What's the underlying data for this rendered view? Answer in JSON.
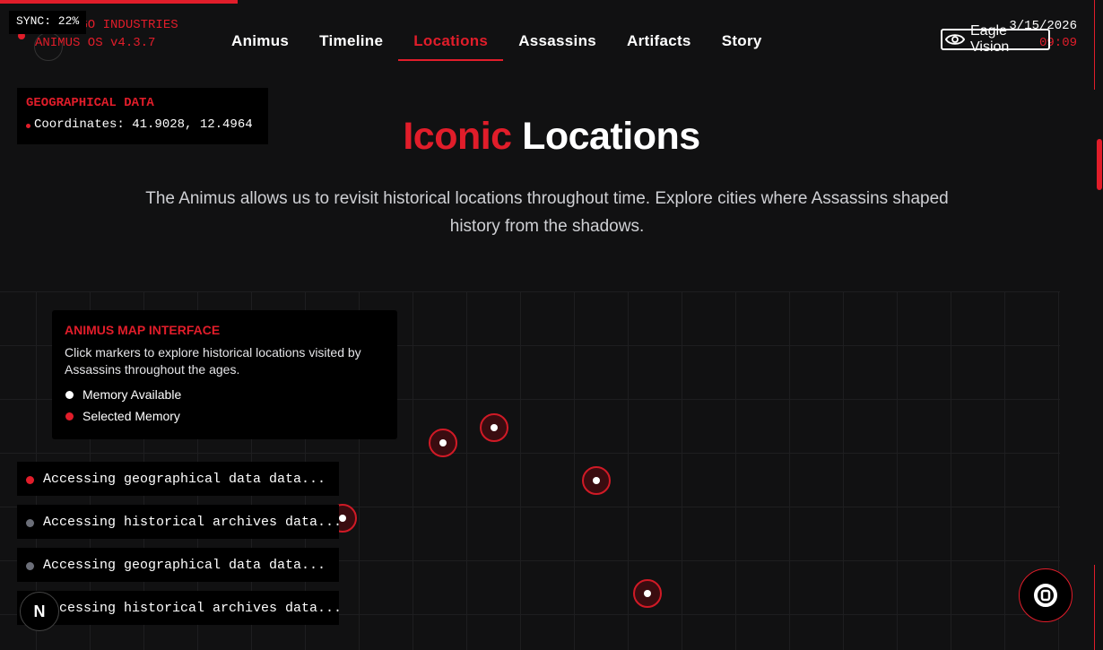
{
  "sync": {
    "label": "SYNC: 22%",
    "progress": 0.22
  },
  "brand": {
    "company": "ABSTERGO INDUSTRIES",
    "os": "ANIMUS OS v4.3.7"
  },
  "nav": {
    "tabs": [
      {
        "label": "Animus"
      },
      {
        "label": "Timeline"
      },
      {
        "label": "Locations"
      },
      {
        "label": "Assassins"
      },
      {
        "label": "Artifacts"
      },
      {
        "label": "Story"
      }
    ],
    "active": "Locations"
  },
  "datetime": {
    "date": "3/15/2026",
    "time": "09:09"
  },
  "eagle_vision": {
    "label": "Eagle Vision"
  },
  "geo": {
    "heading": "GEOGRAPHICAL DATA",
    "coordinates": "Coordinates: 41.9028, 12.4964"
  },
  "hero": {
    "title_accent": "Iconic",
    "title_rest": "Locations",
    "description": "The Animus allows us to revisit historical locations throughout time. Explore cities where Assassins shaped history from the shadows."
  },
  "legend": {
    "heading": "ANIMUS MAP INTERFACE",
    "text": "Click markers to explore historical locations visited by Assassins throughout the ages.",
    "items": [
      {
        "label": "Memory Available"
      },
      {
        "label": "Selected Memory"
      }
    ]
  },
  "logs": [
    {
      "text": "Accessing geographical data data...",
      "status": "active"
    },
    {
      "text": "Accessing historical archives data...",
      "status": "idle"
    },
    {
      "text": "Accessing geographical data data...",
      "status": "idle"
    },
    {
      "text": "Accessing historical archives data...",
      "status": "idle"
    }
  ],
  "dev_badge": {
    "label": "N"
  },
  "colors": {
    "accent": "#e11d2a",
    "background": "#111112",
    "panel": "#000000"
  },
  "icons": {
    "eagle": "eye-icon",
    "fab": "animus-core-icon"
  }
}
